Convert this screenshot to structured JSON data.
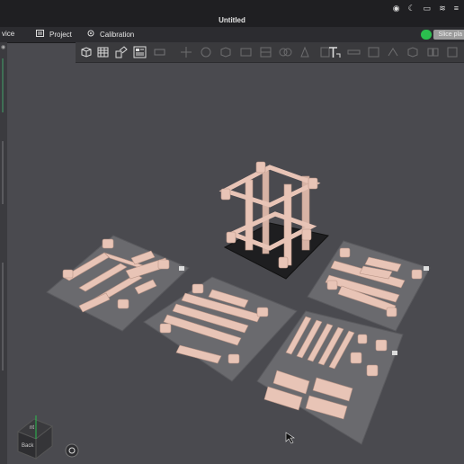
{
  "window": {
    "title": "Untitled"
  },
  "tabs": {
    "device_label": "vice",
    "project_label": "Project",
    "calibration_label": "Calibration"
  },
  "toolbar": {
    "slice_label": "Slice pla"
  },
  "viewcube": {
    "top_label": "nt",
    "front_label": "Back"
  },
  "colors": {
    "background": "#4a4a4f",
    "part": "#e8c4b6",
    "plate": "#6a6a6e",
    "active_plate": "#1e1e20",
    "accent": "#2bbf4e"
  }
}
